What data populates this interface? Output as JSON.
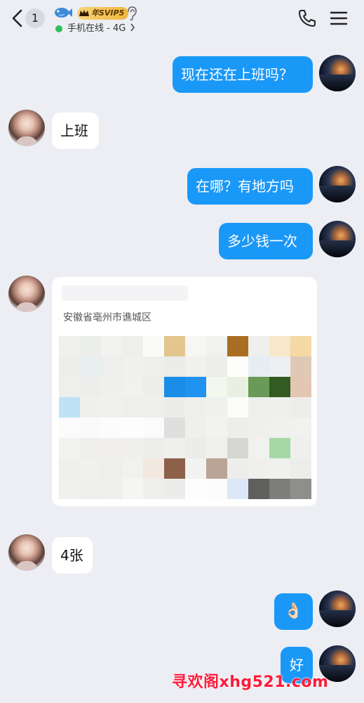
{
  "header": {
    "unread_count": "1",
    "vip_label": "年SVIP5",
    "status_text": "手机在线 - 4G",
    "status_color": "#30c05a",
    "icons": [
      "back-arrow-icon",
      "fish-icon",
      "crown-icon",
      "ear-icon",
      "chevron-right-icon",
      "phone-icon",
      "menu-icon"
    ]
  },
  "messages": [
    {
      "from": "self",
      "text": "现在还在上班吗？"
    },
    {
      "from": "peer",
      "text": "上班"
    },
    {
      "from": "self",
      "text": "在哪？有地方吗"
    },
    {
      "from": "self",
      "text": "多少钱一次"
    },
    {
      "from": "peer",
      "type": "location",
      "address": "安徽省亳州市谯城区"
    },
    {
      "from": "peer",
      "text": "4张"
    },
    {
      "from": "self",
      "text": "👌🏻"
    },
    {
      "from": "self",
      "text": "好"
    }
  ],
  "watermark": "寻欢阁xhg521.com",
  "colors": {
    "outgoing_bubble": "#1a98f7",
    "incoming_bubble": "#ffffff",
    "background": "#eceef4",
    "watermark": "#ff1a3a"
  }
}
